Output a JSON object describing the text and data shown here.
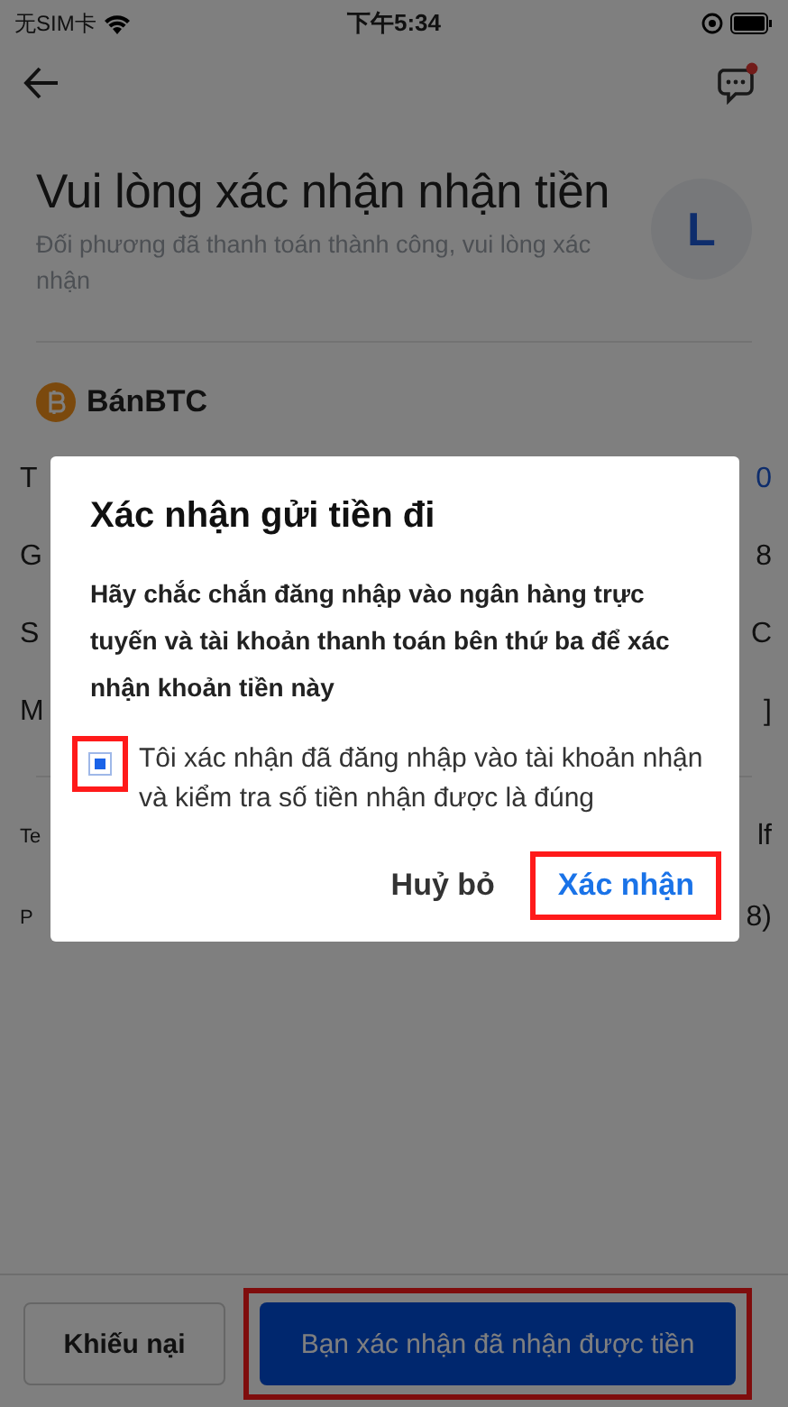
{
  "status_bar": {
    "carrier": "无SIM卡",
    "time": "下午5:34"
  },
  "header": {
    "title": "Vui lòng xác nhận nhận tiền",
    "subtitle": "Đối phương đã thanh toán thành công, vui lòng xác nhận",
    "avatar": "L"
  },
  "asset": {
    "label": "BánBTC"
  },
  "details": [
    {
      "label": "T",
      "value": "0",
      "accent": true
    },
    {
      "label": "G",
      "value": "8",
      "accent": false
    },
    {
      "label": "S",
      "value": "C",
      "accent": false
    },
    {
      "label": "M",
      "value": "]",
      "accent": false
    }
  ],
  "extra_details": [
    {
      "label": "Te",
      "value": "lf"
    },
    {
      "label": "P",
      "value": "8)"
    }
  ],
  "dialog": {
    "title": "Xác nhận gửi tiền đi",
    "message": "Hãy chắc chắn đăng nhập vào ngân hàng trực tuyến và tài khoản thanh toán bên thứ ba để xác nhận khoản tiền này",
    "checkbox": {
      "label": "Tôi xác nhận đã đăng nhập vào tài khoản nhận và kiểm tra số tiền nhận được là đúng",
      "checked": true,
      "highlighted": true
    },
    "buttons": [
      {
        "label": "Huỷ bỏ",
        "kind": "cancel",
        "highlighted": false
      },
      {
        "label": "Xác nhận",
        "kind": "confirm",
        "highlighted": true
      }
    ]
  },
  "footer": {
    "buttons": [
      {
        "label": "Khiếu nại",
        "kind": "secondary",
        "highlighted": false
      },
      {
        "label": "Bạn xác nhận đã nhận được tiền",
        "kind": "primary",
        "highlighted": true
      }
    ]
  }
}
